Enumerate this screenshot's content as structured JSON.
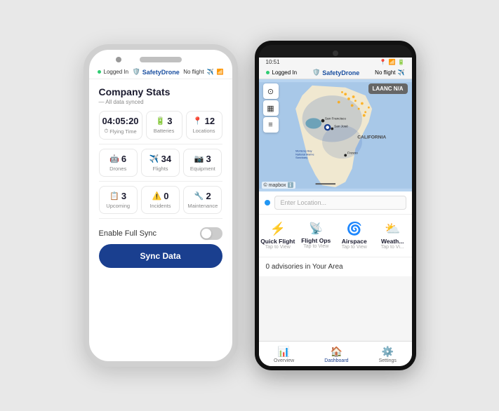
{
  "scene": {
    "background": "#e8e8e8"
  },
  "iphone": {
    "statusBar": {
      "leftText": "Logged In",
      "brandName": "SafetyDrone",
      "rightText": "No flight"
    },
    "companyStats": {
      "title": "Company Stats",
      "syncedLabel": "All data synced",
      "stats": {
        "flyingTime": {
          "value": "04:05:20",
          "label": "Flying Time"
        },
        "batteries": {
          "icon": "🔋",
          "value": "3",
          "label": "Batteries"
        },
        "locations": {
          "icon": "📍",
          "value": "12",
          "label": "Locations"
        },
        "drones": {
          "icon": "🤖",
          "value": "6",
          "label": "Drones"
        },
        "flights": {
          "icon": "✈️",
          "value": "34",
          "label": "Flights"
        },
        "equipment": {
          "icon": "📷",
          "value": "3",
          "label": "Equipment"
        },
        "upcoming": {
          "icon": "📋",
          "value": "3",
          "label": "Upcoming"
        },
        "incidents": {
          "icon": "⚠️",
          "value": "0",
          "label": "Incidents"
        },
        "maintenance": {
          "icon": "🔧",
          "value": "2",
          "label": "Maintenance"
        }
      }
    },
    "enableFullSync": {
      "label": "Enable Full Sync"
    },
    "syncButton": {
      "label": "Sync Data"
    }
  },
  "android": {
    "statusBar": {
      "time": "10:51",
      "rightIcons": "📶🔋"
    },
    "header": {
      "leftText": "Logged In",
      "brandName": "SafetyDrone",
      "rightText": "No flight"
    },
    "map": {
      "laancBadge": "LAANC N/A",
      "mapboxCredit": "© mapbox ℹ️"
    },
    "search": {
      "placeholder": "Enter Location..."
    },
    "quickActions": [
      {
        "icon": "⚡",
        "label": "Quick Flight",
        "sublabel": "Tap to View"
      },
      {
        "icon": "📡",
        "label": "Flight Ops",
        "sublabel": "Tap to View"
      },
      {
        "icon": "🌀",
        "label": "Airspace",
        "sublabel": "Tap to View"
      },
      {
        "icon": "⛅",
        "label": "Weath...",
        "sublabel": "Tap to Vi..."
      }
    ],
    "advisories": {
      "text": "0 advisories in Your Area"
    },
    "nav": [
      {
        "icon": "📊",
        "label": "Overview",
        "active": false
      },
      {
        "icon": "🏠",
        "label": "Dashboard",
        "active": true
      },
      {
        "icon": "⚙️",
        "label": "Settings",
        "active": false
      }
    ]
  }
}
